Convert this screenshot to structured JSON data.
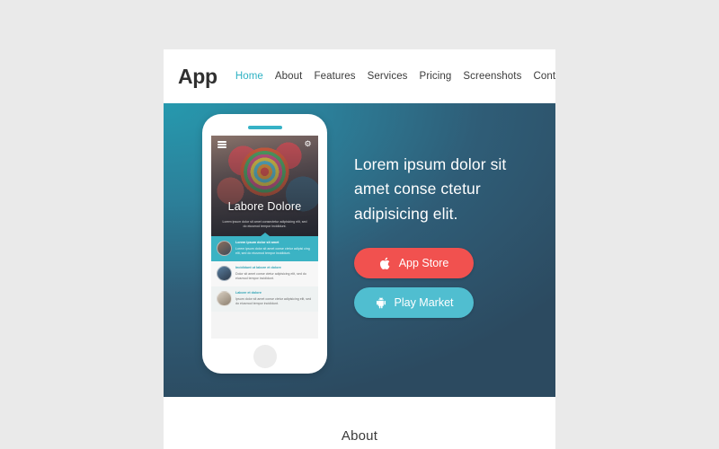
{
  "page": {
    "background_color": "#eaeaea",
    "card_background": "#ffffff"
  },
  "header": {
    "brand": "App",
    "nav": [
      {
        "label": "Home",
        "active": true
      },
      {
        "label": "About",
        "active": false
      },
      {
        "label": "Features",
        "active": false
      },
      {
        "label": "Services",
        "active": false
      },
      {
        "label": "Pricing",
        "active": false
      },
      {
        "label": "Screenshots",
        "active": false
      },
      {
        "label": "Contact",
        "active": false
      }
    ],
    "active_color": "#2fb2c4",
    "link_color": "#3b3b3b"
  },
  "hero": {
    "gradient_from": "#2699ae",
    "gradient_to": "#2c4a60",
    "headline": "Lorem ipsum dolor sit amet conse ctetur adipisicing elit.",
    "buttons": [
      {
        "label": "App Store",
        "icon": "apple-icon",
        "color": "#f1514f"
      },
      {
        "label": "Play Market",
        "icon": "android-icon",
        "color": "#50bed0"
      }
    ],
    "phone": {
      "menu_icon": "hamburger-menu-icon",
      "settings_icon": "gear-icon",
      "screen_title": "Labore Dolore",
      "screen_subtitle": "Lorem ipsum dolor sit amet consectetur adipisicing elit, sed do eiusmod tempor incididunt.",
      "items": [
        {
          "title": "Lorem ipsum dolor sit amet",
          "text": "Lorem ipsum dolor sit amet conse ctetur adipisi cing elit, sed do eiusmod tempor incididunt.",
          "variant": "variant-teal"
        },
        {
          "title": "Incididunt ut labore et dolore",
          "text": "Dolor sit amet conse ctetur adipisicing elit, sed do eiusmod tempor incididunt.",
          "variant": "variant-light"
        },
        {
          "title": "Labore et dolore",
          "text": "Ipsum dolor sit amet conse ctetur adipisicing elit, sed do eiusmod tempor incididunt.",
          "variant": "variant-pale"
        }
      ]
    }
  },
  "about": {
    "title": "About"
  }
}
